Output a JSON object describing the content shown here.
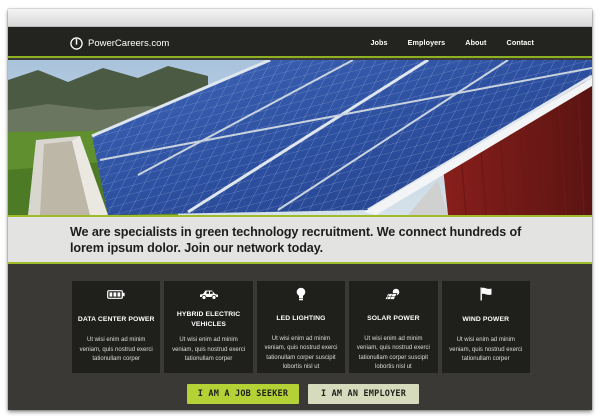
{
  "brand": {
    "name": "PowerCareers.com",
    "logo_icon": "power-icon"
  },
  "nav": {
    "items": [
      "Jobs",
      "Employers",
      "About",
      "Contact"
    ]
  },
  "hero": {
    "image": "solar-panel-roof-photo"
  },
  "tagline": "We are specialists in green technology recruitment. We connect hundreds of lorem ipsum dolor. Join our network today.",
  "features": [
    {
      "icon": "battery-icon",
      "title": "DATA CENTER POWER",
      "text": "Ut wisi enim ad minim veniam, quis nostrud exerci tationullam corper"
    },
    {
      "icon": "car-icon",
      "title": "HYBRID ELECTRIC VEHICLES",
      "text": "Ut wisi enim ad minim veniam, quis nostrud exerci tationullam corper"
    },
    {
      "icon": "light-bulb-icon",
      "title": "LED LIGHTING",
      "text": "Ut wisi enim ad minim veniam, quis nostrud exerci tationullam corper suscipit lobortis nisl ut"
    },
    {
      "icon": "solar-power-icon",
      "title": "SOLAR POWER",
      "text": "Ut wisi enim ad minim veniam, quis nostrud exerci tationullam corper suscipit lobortis nisl ut"
    },
    {
      "icon": "flag-icon",
      "title": "WIND POWER",
      "text": "Ut wisi enim ad minim veniam, quis nostrud exerci tationullam corper"
    }
  ],
  "cta": {
    "seeker_label": "I AM A JOB SEEKER",
    "employer_label": "I AM AN EMPLOYER"
  },
  "colors": {
    "accent": "#b4d236",
    "nav_bg": "#232320",
    "body_bg": "#3a3935",
    "card_bg": "#1f1f1c",
    "strip_bg": "#e3e3e2"
  }
}
